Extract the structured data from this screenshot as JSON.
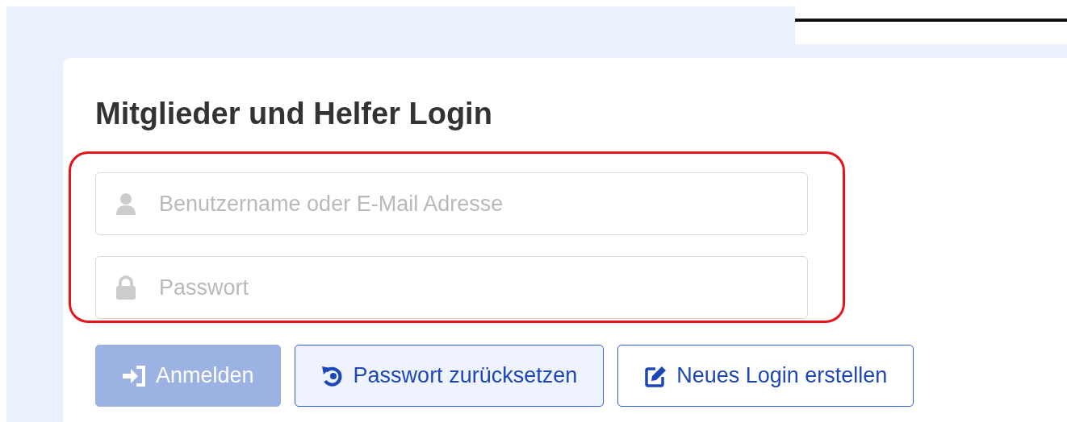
{
  "title": "Mitglieder und Helfer Login",
  "fields": [
    {
      "kind": "user",
      "placeholder": "Benutzername oder E-Mail Adresse"
    },
    {
      "kind": "password",
      "placeholder": "Passwort"
    }
  ],
  "buttons": [
    {
      "kind": "login",
      "label": "Anmelden",
      "disabled": true
    },
    {
      "kind": "reset",
      "label": "Passwort zurücksetzen",
      "disabled": false
    },
    {
      "kind": "register",
      "label": "Neues Login erstellen",
      "disabled": false
    }
  ]
}
